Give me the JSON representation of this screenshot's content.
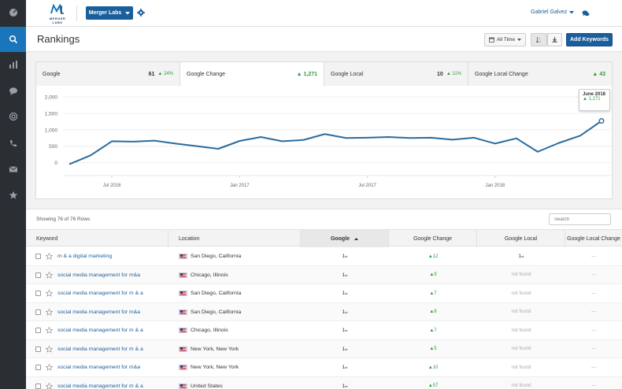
{
  "app": {
    "logo_text": "MERGER LABS",
    "org_button": "Merger Labs",
    "user_name": "Gabriel Galvez",
    "colors": {
      "primary": "#1b5e9c",
      "rail": "#2b2e33",
      "rail_active": "#1b75bb",
      "positive": "#2e9b3c",
      "line": "#2a6c9e"
    }
  },
  "rail": {
    "icons": [
      "dashboard-icon",
      "search-icon",
      "bar-chart-icon",
      "chat-bubble-icon",
      "target-icon",
      "phone-icon",
      "envelope-icon",
      "star-icon"
    ]
  },
  "header": {
    "title": "Rankings",
    "range_button": "All Time",
    "add_button": "Add Keywords"
  },
  "tabs": [
    {
      "label": "Google",
      "value": "61",
      "change": "▲ 24%"
    },
    {
      "label": "Google Change",
      "value": "",
      "change": "▲ 1,271"
    },
    {
      "label": "Google Local",
      "value": "10",
      "change": "▲ 11%"
    },
    {
      "label": "Google Local Change",
      "value": "",
      "change": "▲ 43"
    }
  ],
  "tooltip": {
    "title": "June 2018",
    "value": "▲ 1,271"
  },
  "chart_data": {
    "type": "line",
    "y_ticks": [
      "2,000",
      "1,500",
      "1,000",
      "500",
      "0"
    ],
    "ylim": [
      -300,
      2100
    ],
    "x_ticks": [
      {
        "label": "Jul 2016",
        "index": 2
      },
      {
        "label": "Jan 2017",
        "index": 8
      },
      {
        "label": "Jul 2017",
        "index": 14
      },
      {
        "label": "Jan 2018",
        "index": 20
      }
    ],
    "values": [
      -50,
      220,
      650,
      640,
      670,
      580,
      500,
      420,
      660,
      780,
      650,
      690,
      870,
      750,
      760,
      780,
      750,
      760,
      700,
      760,
      580,
      740,
      330,
      600,
      820,
      1271
    ],
    "grid": true
  },
  "table": {
    "showing": "Showing 76 of 76 Rows",
    "search_placeholder": "Search",
    "columns": [
      "Keyword",
      "Location",
      "Google",
      "Google Change",
      "Google Local",
      "Google Local Change"
    ],
    "rows": [
      {
        "keyword": "m & a digital marketing",
        "location": "San Diego, California",
        "google": "1",
        "google_sup": "st",
        "change": "▲12",
        "local": "1",
        "local_sup": "st",
        "local_change": "---"
      },
      {
        "keyword": "social media management for m&a",
        "location": "Chicago, Illinois",
        "google": "1",
        "google_sup": "st",
        "change": "▲9",
        "local": "not found",
        "local_sup": "",
        "local_change": "---"
      },
      {
        "keyword": "social media management for m & a",
        "location": "San Diego, California",
        "google": "1",
        "google_sup": "st",
        "change": "▲7",
        "local": "not found",
        "local_sup": "",
        "local_change": "---"
      },
      {
        "keyword": "social media management for m&a",
        "location": "San Diego, California",
        "google": "1",
        "google_sup": "st",
        "change": "▲8",
        "local": "not found",
        "local_sup": "",
        "local_change": "---"
      },
      {
        "keyword": "social media management for m & a",
        "location": "Chicago, Illinois",
        "google": "1",
        "google_sup": "st",
        "change": "▲7",
        "local": "not found",
        "local_sup": "",
        "local_change": "---"
      },
      {
        "keyword": "social media management for m & a",
        "location": "New York, New York",
        "google": "1",
        "google_sup": "st",
        "change": "▲5",
        "local": "not found",
        "local_sup": "",
        "local_change": "---"
      },
      {
        "keyword": "social media management for m&a",
        "location": "New York, New York",
        "google": "1",
        "google_sup": "st",
        "change": "▲10",
        "local": "not found",
        "local_sup": "",
        "local_change": "---"
      },
      {
        "keyword": "social media management for m & a",
        "location": "United States",
        "google": "1",
        "google_sup": "st",
        "change": "▲57",
        "local": "not found",
        "local_sup": "",
        "local_change": "---"
      }
    ]
  }
}
